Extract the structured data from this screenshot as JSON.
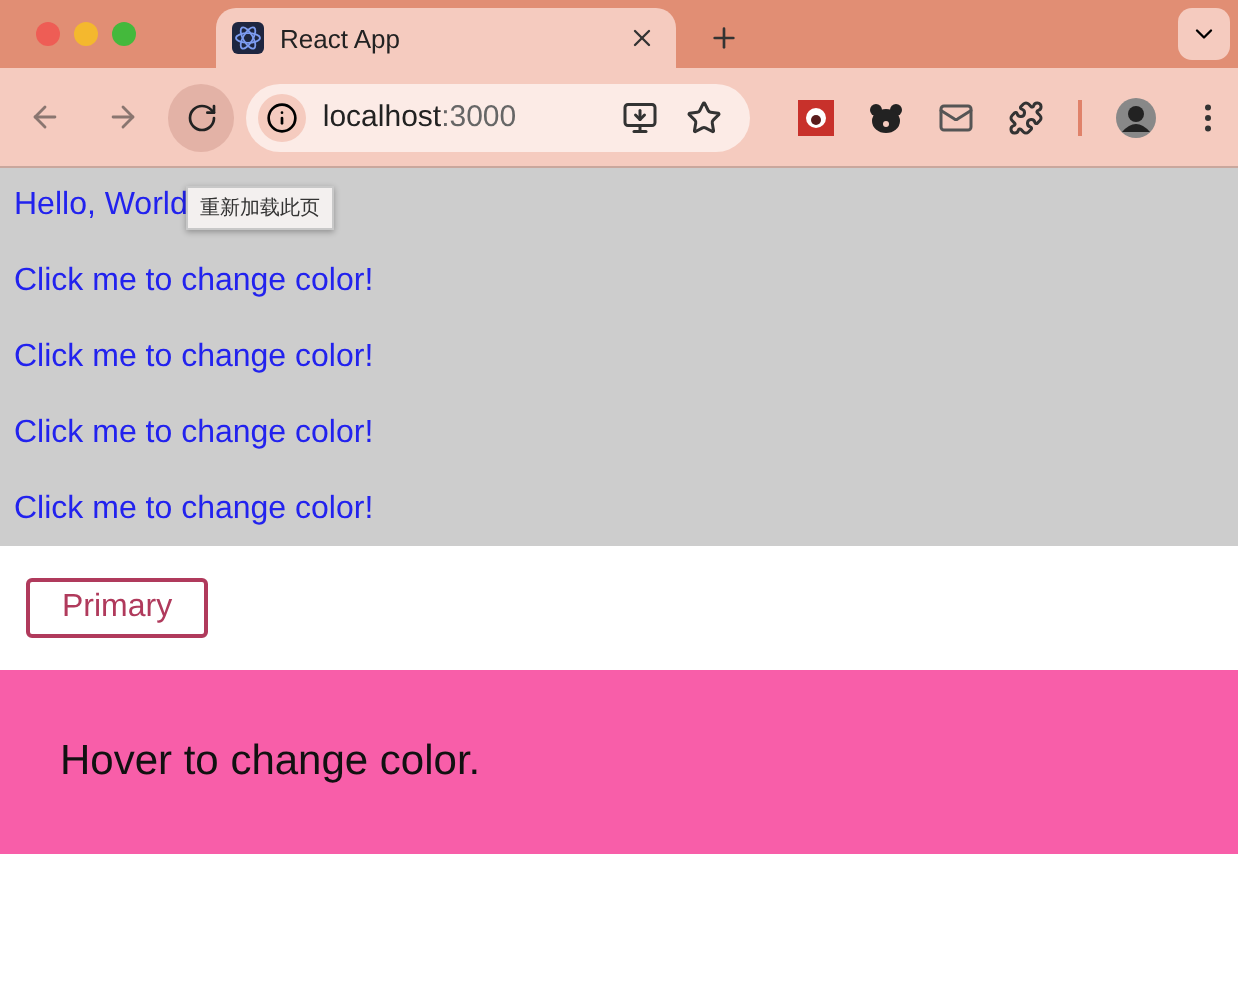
{
  "tab": {
    "title": "React App",
    "selected": true
  },
  "address": {
    "host": "localhost",
    "port": ":3000"
  },
  "tooltip": "重新加载此页",
  "lines": [
    "Hello, World",
    "Click me to change color!",
    "Click me to change color!",
    "Click me to change color!",
    "Click me to change color!"
  ],
  "button": "Primary",
  "hover_box": "Hover to change color."
}
